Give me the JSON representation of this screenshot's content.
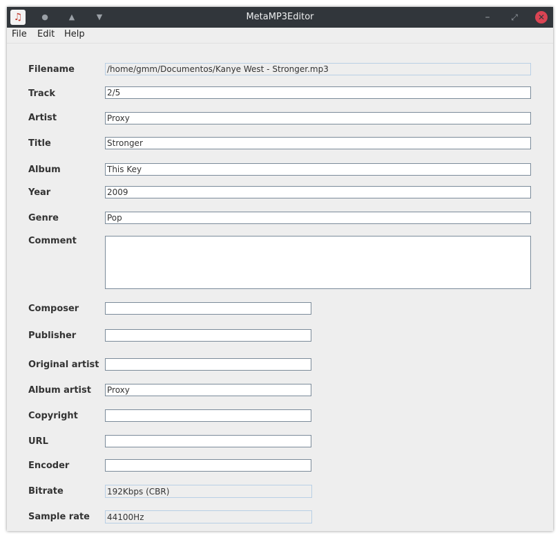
{
  "window": {
    "title": "MetaMP3Editor"
  },
  "titlebar": {
    "buttons": [
      "pin-icon",
      "keep-above-icon",
      "keep-below-icon",
      "minimize-icon",
      "maximize-icon",
      "close-icon"
    ]
  },
  "menu": {
    "file": "File",
    "edit": "Edit",
    "help": "Help"
  },
  "form": {
    "filename": {
      "label": "Filename",
      "value": "/home/gmm/Documentos/Kanye West - Stronger.mp3"
    },
    "track": {
      "label": "Track",
      "value": "2/5"
    },
    "artist": {
      "label": "Artist",
      "value": "Proxy"
    },
    "title": {
      "label": "Title",
      "value": "Stronger"
    },
    "album": {
      "label": "Album",
      "value": "This Key"
    },
    "year": {
      "label": "Year",
      "value": "2009"
    },
    "genre": {
      "label": "Genre",
      "value": "Pop"
    },
    "comment": {
      "label": "Comment",
      "value": ""
    },
    "composer": {
      "label": "Composer",
      "value": ""
    },
    "publisher": {
      "label": "Publisher",
      "value": ""
    },
    "original_artist": {
      "label": "Original artist",
      "value": ""
    },
    "album_artist": {
      "label": "Album artist",
      "value": "Proxy"
    },
    "copyright": {
      "label": "Copyright",
      "value": ""
    },
    "url": {
      "label": "URL",
      "value": ""
    },
    "encoder": {
      "label": "Encoder",
      "value": ""
    },
    "bitrate": {
      "label": "Bitrate",
      "value": "192Kbps (CBR)"
    },
    "sample_rate": {
      "label": "Sample rate",
      "value": "44100Hz"
    }
  }
}
